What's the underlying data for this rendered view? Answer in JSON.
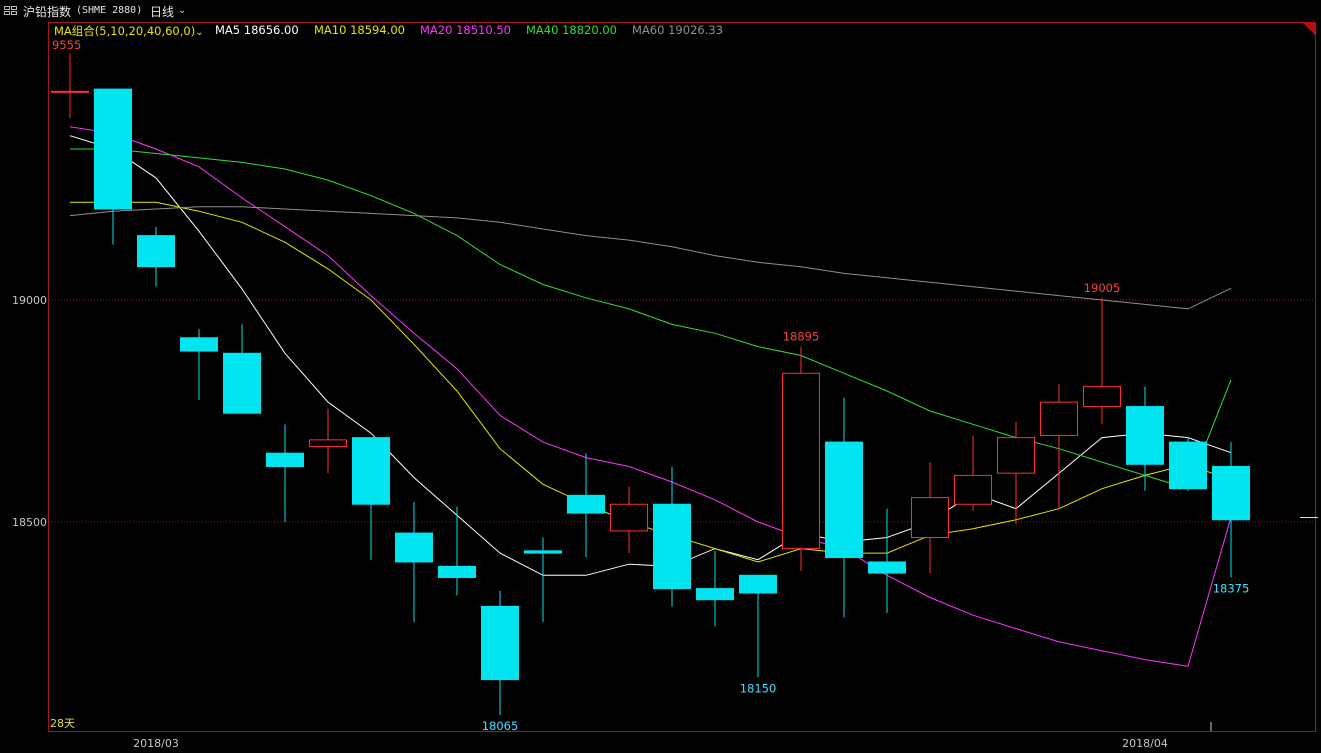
{
  "window": {
    "name": "沪铅指数",
    "code": "(SHME 2880)",
    "period": "日线"
  },
  "legend": {
    "group_label": "MA组合(5,10,20,40,60,0)",
    "items": [
      {
        "label": "MA5",
        "value": "18656.00",
        "color": "#ffffff"
      },
      {
        "label": "MA10",
        "value": "18594.00",
        "color": "#e6e600"
      },
      {
        "label": "MA20",
        "value": "18510.50",
        "color": "#ff33ff"
      },
      {
        "label": "MA40",
        "value": "18820.00",
        "color": "#33dd33"
      },
      {
        "label": "MA60",
        "value": "19026.33",
        "color": "#909090"
      }
    ]
  },
  "colors": {
    "up": "#ff3030",
    "down": "#00e5f0",
    "grid": "#8b1a1a",
    "frame": "#a01818"
  },
  "chart_data": {
    "type": "candlestick",
    "instrument": "沪铅指数 (SHME 2880)",
    "period": "日线",
    "y_ticks": [
      19000,
      18500
    ],
    "x_ticks": [
      {
        "label": "2018/03",
        "index": 2
      },
      {
        "label": "2018/04",
        "index": 25
      }
    ],
    "visible_days_label": "28天",
    "top_value_label": "9555",
    "candles": [
      {
        "open": 19470,
        "high": 19555,
        "low": 19410,
        "close": 19470
      },
      {
        "open": 19475,
        "high": 19475,
        "low": 19125,
        "close": 19205
      },
      {
        "open": 19145,
        "high": 19165,
        "low": 19030,
        "close": 19075
      },
      {
        "open": 18915,
        "high": 18935,
        "low": 18775,
        "close": 18885
      },
      {
        "open": 18880,
        "high": 18945,
        "low": 18745,
        "close": 18745
      },
      {
        "open": 18655,
        "high": 18720,
        "low": 18500,
        "close": 18625
      },
      {
        "open": 18670,
        "high": 18755,
        "low": 18610,
        "close": 18685
      },
      {
        "open": 18690,
        "high": 18690,
        "low": 18415,
        "close": 18540
      },
      {
        "open": 18475,
        "high": 18545,
        "low": 18275,
        "close": 18410
      },
      {
        "open": 18400,
        "high": 18535,
        "low": 18335,
        "close": 18375
      },
      {
        "open": 18310,
        "high": 18345,
        "low": 18065,
        "close": 18145
      },
      {
        "open": 18435,
        "high": 18465,
        "low": 18275,
        "close": 18430
      },
      {
        "open": 18560,
        "high": 18655,
        "low": 18420,
        "close": 18520
      },
      {
        "open": 18480,
        "high": 18580,
        "low": 18430,
        "close": 18540
      },
      {
        "open": 18540,
        "high": 18625,
        "low": 18310,
        "close": 18350
      },
      {
        "open": 18350,
        "high": 18435,
        "low": 18265,
        "close": 18325
      },
      {
        "open": 18380,
        "high": 18380,
        "low": 18150,
        "close": 18340
      },
      {
        "open": 18440,
        "high": 18895,
        "low": 18390,
        "close": 18835
      },
      {
        "open": 18680,
        "high": 18780,
        "low": 18285,
        "close": 18420
      },
      {
        "open": 18410,
        "high": 18530,
        "low": 18295,
        "close": 18385
      },
      {
        "open": 18465,
        "high": 18635,
        "low": 18385,
        "close": 18555
      },
      {
        "open": 18540,
        "high": 18695,
        "low": 18525,
        "close": 18605
      },
      {
        "open": 18610,
        "high": 18725,
        "low": 18495,
        "close": 18690
      },
      {
        "open": 18695,
        "high": 18810,
        "low": 18530,
        "close": 18770
      },
      {
        "open": 18760,
        "high": 19005,
        "low": 18720,
        "close": 18805
      },
      {
        "open": 18760,
        "high": 18805,
        "low": 18570,
        "close": 18630
      },
      {
        "open": 18680,
        "high": 18690,
        "low": 18570,
        "close": 18575
      },
      {
        "open": 18625,
        "high": 18680,
        "low": 18375,
        "close": 18505
      }
    ],
    "ma": [
      {
        "name": "MA5",
        "color": "#ffffff",
        "values": [
          19370,
          19340,
          19275,
          19155,
          19025,
          18880,
          18770,
          18700,
          18600,
          18515,
          18430,
          18380,
          18380,
          18405,
          18400,
          18440,
          18415,
          18475,
          18455,
          18465,
          18500,
          18565,
          18530,
          18610,
          18690,
          18700,
          18690,
          18656
        ]
      },
      {
        "name": "MA10",
        "color": "#e6e600",
        "values": [
          19220,
          19220,
          19220,
          19200,
          19175,
          19130,
          19070,
          19000,
          18900,
          18795,
          18665,
          18585,
          18540,
          18500,
          18470,
          18440,
          18410,
          18440,
          18430,
          18430,
          18470,
          18485,
          18505,
          18530,
          18575,
          18605,
          18630,
          18594
        ]
      },
      {
        "name": "MA20",
        "color": "#ff33ff",
        "values": [
          19390,
          19375,
          19340,
          19300,
          19230,
          19165,
          19100,
          19010,
          18925,
          18845,
          18740,
          18680,
          18645,
          18625,
          18590,
          18550,
          18500,
          18465,
          18440,
          18380,
          18330,
          18290,
          18260,
          18230,
          18210,
          18190,
          18175,
          18510.5
        ]
      },
      {
        "name": "MA40",
        "color": "#33dd33",
        "values": [
          19340,
          19340,
          19330,
          19320,
          19310,
          19295,
          19270,
          19235,
          19195,
          19145,
          19080,
          19035,
          19005,
          18980,
          18945,
          18925,
          18895,
          18875,
          18835,
          18795,
          18750,
          18720,
          18690,
          18665,
          18635,
          18605,
          18575,
          18820
        ]
      },
      {
        "name": "MA60",
        "color": "#909090",
        "values": [
          19190,
          19200,
          19205,
          19210,
          19210,
          19205,
          19200,
          19195,
          19190,
          19185,
          19175,
          19160,
          19145,
          19135,
          19120,
          19100,
          19085,
          19075,
          19060,
          19050,
          19040,
          19030,
          19020,
          19010,
          19000,
          18990,
          18980,
          19026.33
        ]
      }
    ],
    "annotations": [
      {
        "text": "18895",
        "index": 17,
        "value": 18895,
        "kind": "high"
      },
      {
        "text": "19005",
        "index": 24,
        "value": 19005,
        "kind": "high"
      },
      {
        "text": "18065",
        "index": 10,
        "value": 18065,
        "kind": "low"
      },
      {
        "text": "18150",
        "index": 16,
        "value": 18150,
        "kind": "low"
      },
      {
        "text": "18375",
        "index": 27,
        "value": 18375,
        "kind": "low"
      }
    ]
  }
}
